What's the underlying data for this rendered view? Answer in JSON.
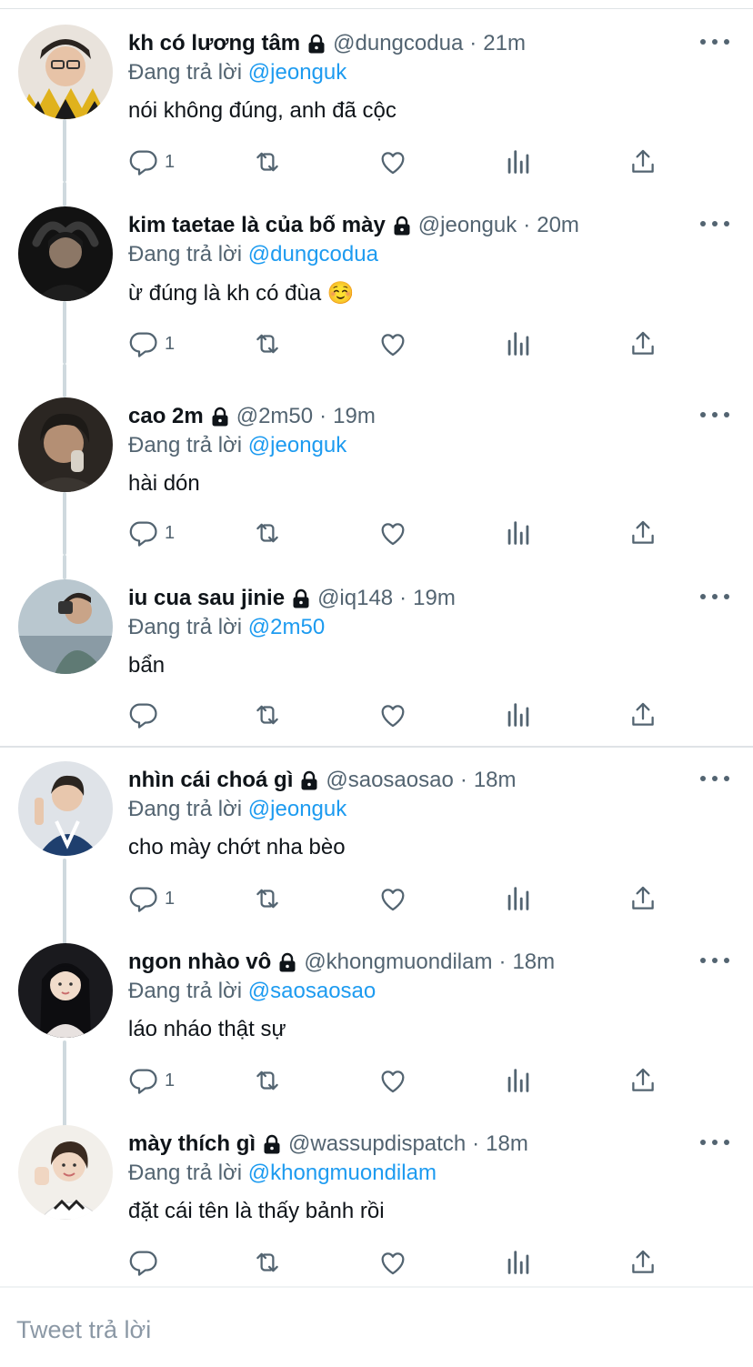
{
  "reply_prefix": "Đang trả lời",
  "tweets": [
    {
      "name": "kh có lương tâm",
      "handle": "@dungcodua",
      "time": "21m",
      "reply_to": "@jeonguk",
      "text": "nói không đúng, anh đã cộc",
      "reply_count": "1"
    },
    {
      "name": "kim taetae là của bố mày",
      "handle": "@jeonguk",
      "time": "20m",
      "reply_to": "@dungcodua",
      "text": "ừ đúng là kh có đùa ☺️",
      "reply_count": "1"
    },
    {
      "name": "cao 2m",
      "handle": "@2m50",
      "time": "19m",
      "reply_to": "@jeonguk",
      "text": "hài dón",
      "reply_count": "1"
    },
    {
      "name": "iu cua sau jinie",
      "handle": "@iq148",
      "time": "19m",
      "reply_to": "@2m50",
      "text": "bẩn",
      "reply_count": ""
    },
    {
      "name": "nhìn cái choá gì",
      "handle": "@saosaosao",
      "time": "18m",
      "reply_to": "@jeonguk",
      "text": "cho mày chớt nha bèo",
      "reply_count": "1"
    },
    {
      "name": "ngon nhào vô",
      "handle": "@khongmuondilam",
      "time": "18m",
      "reply_to": "@saosaosao",
      "text": "láo nháo thật sự",
      "reply_count": "1"
    },
    {
      "name": "mày thích gì",
      "handle": "@wassupdispatch",
      "time": "18m",
      "reply_to": "@khongmuondilam",
      "text": "đặt cái tên là thấy bảnh rồi",
      "reply_count": ""
    }
  ],
  "composer": {
    "placeholder": "Tweet trả lời"
  },
  "colors": {
    "accent": "#1d9bf0",
    "secondary_text": "#536471",
    "primary_text": "#0f1419"
  },
  "icons": [
    "reply-icon",
    "retweet-icon",
    "like-icon",
    "stats-icon",
    "share-icon",
    "lock-icon",
    "more-icon"
  ]
}
